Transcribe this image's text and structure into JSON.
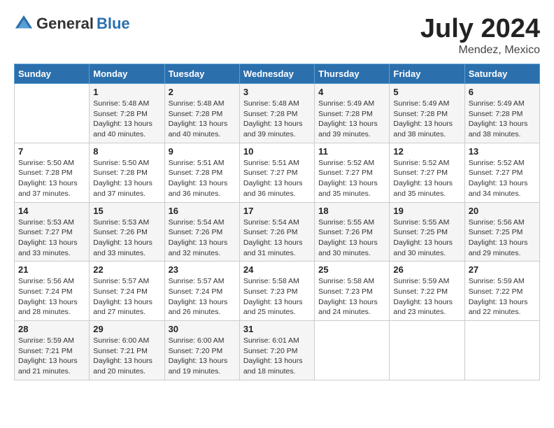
{
  "header": {
    "logo_general": "General",
    "logo_blue": "Blue",
    "title": "July 2024",
    "location": "Mendez, Mexico"
  },
  "days_of_week": [
    "Sunday",
    "Monday",
    "Tuesday",
    "Wednesday",
    "Thursday",
    "Friday",
    "Saturday"
  ],
  "weeks": [
    [
      {
        "day": "",
        "info": ""
      },
      {
        "day": "1",
        "info": "Sunrise: 5:48 AM\nSunset: 7:28 PM\nDaylight: 13 hours\nand 40 minutes."
      },
      {
        "day": "2",
        "info": "Sunrise: 5:48 AM\nSunset: 7:28 PM\nDaylight: 13 hours\nand 40 minutes."
      },
      {
        "day": "3",
        "info": "Sunrise: 5:48 AM\nSunset: 7:28 PM\nDaylight: 13 hours\nand 39 minutes."
      },
      {
        "day": "4",
        "info": "Sunrise: 5:49 AM\nSunset: 7:28 PM\nDaylight: 13 hours\nand 39 minutes."
      },
      {
        "day": "5",
        "info": "Sunrise: 5:49 AM\nSunset: 7:28 PM\nDaylight: 13 hours\nand 38 minutes."
      },
      {
        "day": "6",
        "info": "Sunrise: 5:49 AM\nSunset: 7:28 PM\nDaylight: 13 hours\nand 38 minutes."
      }
    ],
    [
      {
        "day": "7",
        "info": "Sunrise: 5:50 AM\nSunset: 7:28 PM\nDaylight: 13 hours\nand 37 minutes."
      },
      {
        "day": "8",
        "info": "Sunrise: 5:50 AM\nSunset: 7:28 PM\nDaylight: 13 hours\nand 37 minutes."
      },
      {
        "day": "9",
        "info": "Sunrise: 5:51 AM\nSunset: 7:28 PM\nDaylight: 13 hours\nand 36 minutes."
      },
      {
        "day": "10",
        "info": "Sunrise: 5:51 AM\nSunset: 7:27 PM\nDaylight: 13 hours\nand 36 minutes."
      },
      {
        "day": "11",
        "info": "Sunrise: 5:52 AM\nSunset: 7:27 PM\nDaylight: 13 hours\nand 35 minutes."
      },
      {
        "day": "12",
        "info": "Sunrise: 5:52 AM\nSunset: 7:27 PM\nDaylight: 13 hours\nand 35 minutes."
      },
      {
        "day": "13",
        "info": "Sunrise: 5:52 AM\nSunset: 7:27 PM\nDaylight: 13 hours\nand 34 minutes."
      }
    ],
    [
      {
        "day": "14",
        "info": "Sunrise: 5:53 AM\nSunset: 7:27 PM\nDaylight: 13 hours\nand 33 minutes."
      },
      {
        "day": "15",
        "info": "Sunrise: 5:53 AM\nSunset: 7:26 PM\nDaylight: 13 hours\nand 33 minutes."
      },
      {
        "day": "16",
        "info": "Sunrise: 5:54 AM\nSunset: 7:26 PM\nDaylight: 13 hours\nand 32 minutes."
      },
      {
        "day": "17",
        "info": "Sunrise: 5:54 AM\nSunset: 7:26 PM\nDaylight: 13 hours\nand 31 minutes."
      },
      {
        "day": "18",
        "info": "Sunrise: 5:55 AM\nSunset: 7:26 PM\nDaylight: 13 hours\nand 30 minutes."
      },
      {
        "day": "19",
        "info": "Sunrise: 5:55 AM\nSunset: 7:25 PM\nDaylight: 13 hours\nand 30 minutes."
      },
      {
        "day": "20",
        "info": "Sunrise: 5:56 AM\nSunset: 7:25 PM\nDaylight: 13 hours\nand 29 minutes."
      }
    ],
    [
      {
        "day": "21",
        "info": "Sunrise: 5:56 AM\nSunset: 7:24 PM\nDaylight: 13 hours\nand 28 minutes."
      },
      {
        "day": "22",
        "info": "Sunrise: 5:57 AM\nSunset: 7:24 PM\nDaylight: 13 hours\nand 27 minutes."
      },
      {
        "day": "23",
        "info": "Sunrise: 5:57 AM\nSunset: 7:24 PM\nDaylight: 13 hours\nand 26 minutes."
      },
      {
        "day": "24",
        "info": "Sunrise: 5:58 AM\nSunset: 7:23 PM\nDaylight: 13 hours\nand 25 minutes."
      },
      {
        "day": "25",
        "info": "Sunrise: 5:58 AM\nSunset: 7:23 PM\nDaylight: 13 hours\nand 24 minutes."
      },
      {
        "day": "26",
        "info": "Sunrise: 5:59 AM\nSunset: 7:22 PM\nDaylight: 13 hours\nand 23 minutes."
      },
      {
        "day": "27",
        "info": "Sunrise: 5:59 AM\nSunset: 7:22 PM\nDaylight: 13 hours\nand 22 minutes."
      }
    ],
    [
      {
        "day": "28",
        "info": "Sunrise: 5:59 AM\nSunset: 7:21 PM\nDaylight: 13 hours\nand 21 minutes."
      },
      {
        "day": "29",
        "info": "Sunrise: 6:00 AM\nSunset: 7:21 PM\nDaylight: 13 hours\nand 20 minutes."
      },
      {
        "day": "30",
        "info": "Sunrise: 6:00 AM\nSunset: 7:20 PM\nDaylight: 13 hours\nand 19 minutes."
      },
      {
        "day": "31",
        "info": "Sunrise: 6:01 AM\nSunset: 7:20 PM\nDaylight: 13 hours\nand 18 minutes."
      },
      {
        "day": "",
        "info": ""
      },
      {
        "day": "",
        "info": ""
      },
      {
        "day": "",
        "info": ""
      }
    ]
  ]
}
